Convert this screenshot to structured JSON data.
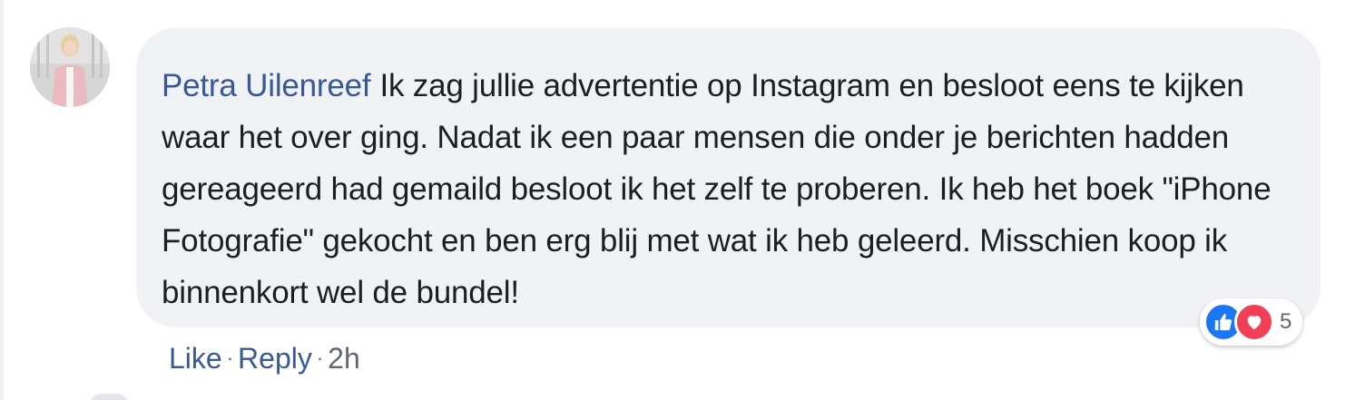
{
  "comment": {
    "author": "Petra Uilenreef",
    "text": "Ik zag jullie advertentie op Instagram en besloot eens te kijken waar het over ging. Nadat ik een paar mensen die onder je berichten hadden gereageerd had gemaild besloot ik het zelf te proberen. Ik heb het boek \"iPhone Fotografie\" gekocht en ben erg blij met wat ik heb geleerd. Misschien koop ik binnenkort wel de bundel!",
    "reactions": {
      "icons": [
        "like-icon",
        "love-icon"
      ],
      "count": "5"
    },
    "actions": {
      "like_label": "Like",
      "separator": "·",
      "reply_label": "Reply",
      "timestamp": "2h"
    }
  },
  "colors": {
    "link": "#385898",
    "bubble": "#f0f2f5",
    "text": "#1c1e21",
    "meta": "#616770",
    "like": "#1a76f2",
    "love": "#f33e58"
  }
}
